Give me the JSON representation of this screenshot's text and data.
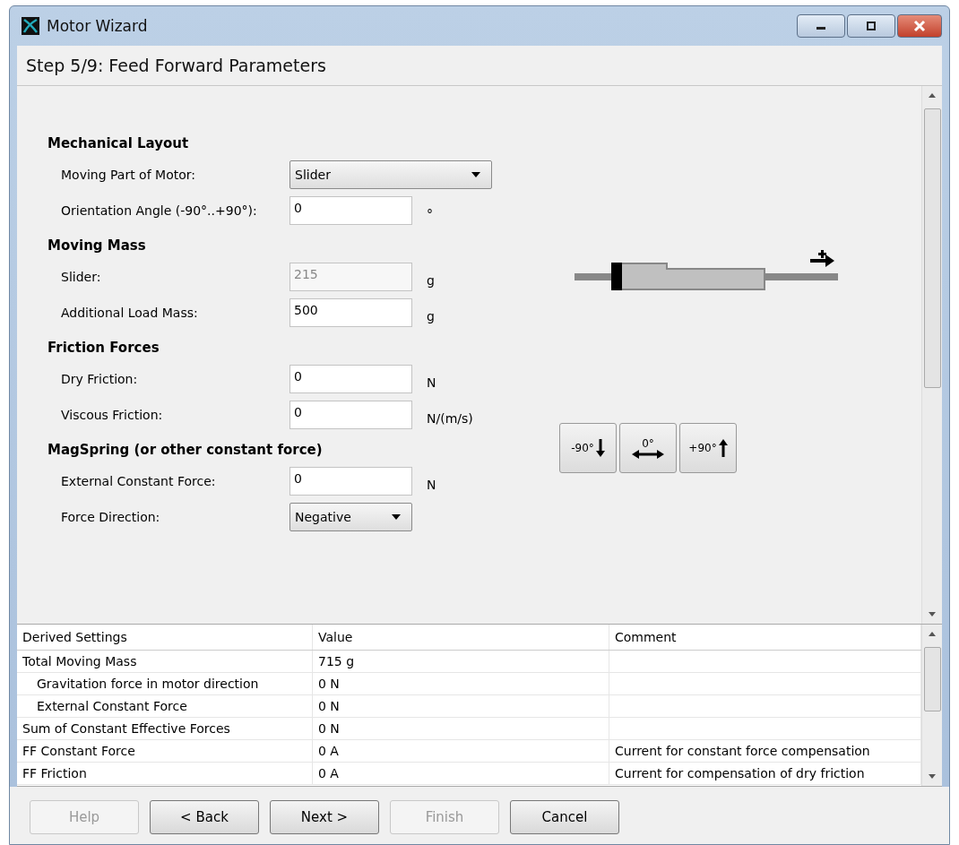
{
  "window": {
    "title": "Motor Wizard"
  },
  "step_title": "Step 5/9: Feed Forward Parameters",
  "sections": [
    {
      "heading": "Mechanical Layout",
      "fields": [
        {
          "kind": "dropdown",
          "wide": true,
          "label": "Moving Part of Motor:",
          "value": "Slider"
        },
        {
          "kind": "text",
          "label": "Orientation Angle (-90°..+90°):",
          "value": "0",
          "unit": "°",
          "disabled": false
        }
      ]
    },
    {
      "heading": "Moving Mass",
      "fields": [
        {
          "kind": "text",
          "label": "Slider:",
          "value": "215",
          "unit": "g",
          "disabled": true
        },
        {
          "kind": "text",
          "label": "Additional Load Mass:",
          "value": "500",
          "unit": "g",
          "disabled": false
        }
      ]
    },
    {
      "heading": "Friction Forces",
      "fields": [
        {
          "kind": "text",
          "label": "Dry Friction:",
          "value": "0",
          "unit": "N",
          "disabled": false
        },
        {
          "kind": "text",
          "label": "Viscous Friction:",
          "value": "0",
          "unit": "N/(m/s)",
          "disabled": false
        }
      ]
    },
    {
      "heading": "MagSpring (or other constant force)",
      "fields": [
        {
          "kind": "text",
          "label": "External Constant Force:",
          "value": "0",
          "unit": "N",
          "disabled": false
        },
        {
          "kind": "dropdown",
          "wide": false,
          "label": "Force Direction:",
          "value": "Negative"
        }
      ]
    }
  ],
  "orientation_buttons": [
    {
      "kind": "down",
      "label": "-90°"
    },
    {
      "kind": "both",
      "label": "0°"
    },
    {
      "kind": "up",
      "label": "+90°"
    }
  ],
  "table": {
    "columns": [
      "Derived Settings",
      "Value",
      "Comment"
    ],
    "rows": [
      {
        "name": "Total Moving Mass",
        "value": "715 g",
        "children": [
          {
            "name": "Gravitation force in motor direction",
            "value": "0 N"
          },
          {
            "name": "External Constant Force",
            "value": "0 N"
          }
        ]
      },
      {
        "name": "Sum of Constant Effective Forces",
        "value": "0 N"
      },
      {
        "name": "FF Constant Force",
        "value": "0 A",
        "comment": "Current for constant force compensation"
      },
      {
        "name": "FF Friction",
        "value": "0 A",
        "comment": "Current for compensation of dry friction"
      }
    ]
  },
  "buttons": [
    {
      "label": "Help",
      "disabled": true
    },
    {
      "label": "< Back",
      "disabled": false
    },
    {
      "label": "Next >",
      "disabled": false
    },
    {
      "label": "Finish",
      "disabled": true
    },
    {
      "label": "Cancel",
      "disabled": false
    }
  ]
}
